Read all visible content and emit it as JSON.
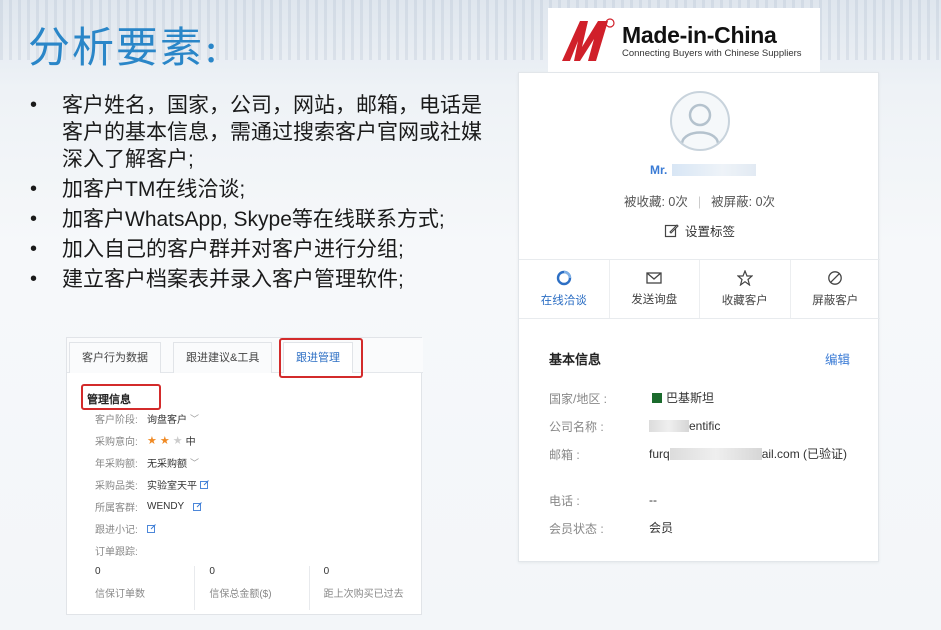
{
  "slide": {
    "title": "分析要素:",
    "bullets": [
      "客户姓名，国家，公司，网站，邮箱，电话是客户的基本信息，需通过搜索客户官网或社媒深入了解客户;",
      "加客户TM在线洽谈;",
      "加客户WhatsApp, Skype等在线联系方式;",
      "加入自己的客户群并对客户进行分组;",
      "建立客户档案表并录入客户管理软件;"
    ]
  },
  "logo": {
    "name": "Made-in-China",
    "tagline": "Connecting Buyers with Chinese Suppliers",
    "brand_color": "#d0202a"
  },
  "profile": {
    "name_prefix": "Mr.",
    "favorited": "被收藏: 0次",
    "blocked": "被屏蔽: 0次",
    "set_tag": "设置标签",
    "actions": [
      {
        "label": "在线洽谈",
        "icon": "chat-icon"
      },
      {
        "label": "发送询盘",
        "icon": "envelope-icon"
      },
      {
        "label": "收藏客户",
        "icon": "star-icon"
      },
      {
        "label": "屏蔽客户",
        "icon": "block-icon"
      }
    ],
    "basic_info_title": "基本信息",
    "edit_label": "编辑",
    "fields": [
      {
        "label": "国家/地区 :",
        "value": "巴基斯坦"
      },
      {
        "label": "公司名称 :",
        "value": "entific"
      },
      {
        "label": "邮箱 :",
        "value_start": "furq",
        "value_end": "ail.com (已验证)"
      },
      {
        "label": "电话 :",
        "value": "--"
      },
      {
        "label": "会员状态 :",
        "value": "会员"
      }
    ],
    "accent_color": "#3a7bd5"
  },
  "panel": {
    "tabs": [
      "客户行为数据",
      "跟进建议&工具",
      "跟进管理"
    ],
    "management_title": "管理信息",
    "rows": [
      {
        "label": "客户阶段:",
        "value": "询盘客户"
      },
      {
        "label": "采购意向:",
        "value": "中",
        "stars": 2,
        "stars_max": 3
      },
      {
        "label": "年采购额:",
        "value": "无采购额"
      },
      {
        "label": "采购品类:",
        "value": "实验室天平"
      },
      {
        "label": "所属客群:",
        "value": "WENDY"
      },
      {
        "label": "跟进小记:",
        "value": ""
      },
      {
        "label": "订单跟踪:",
        "value": ""
      }
    ],
    "stats": [
      {
        "value": "0",
        "label": "信保订单数"
      },
      {
        "value": "0",
        "label": "信保总金额($)"
      },
      {
        "value": "0",
        "label": "距上次购买已过去"
      }
    ],
    "highlight_color": "#d32b2b"
  }
}
